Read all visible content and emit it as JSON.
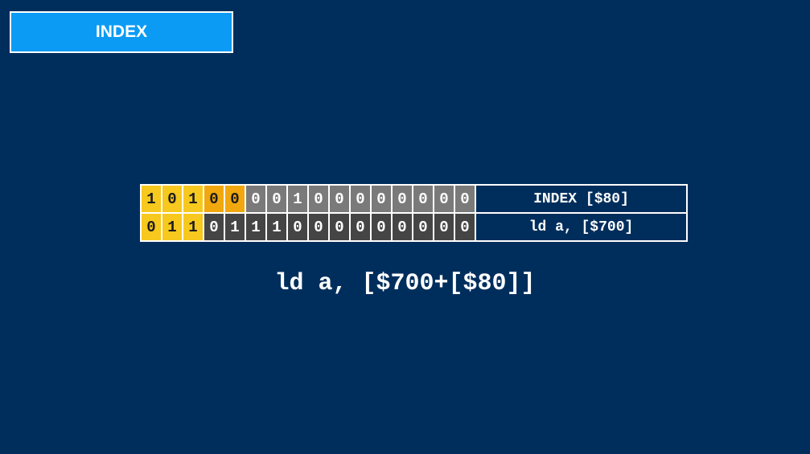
{
  "title": "INDEX",
  "rows": [
    {
      "bits": [
        "1",
        "0",
        "1",
        "0",
        "0",
        "0",
        "0",
        "1",
        "0",
        "0",
        "0",
        "0",
        "0",
        "0",
        "0",
        "0"
      ],
      "colors": [
        "yellow",
        "yellow",
        "yellow",
        "orange",
        "orange",
        "lightgray",
        "lightgray",
        "lightgray",
        "lightgray",
        "lightgray",
        "lightgray",
        "lightgray",
        "lightgray",
        "lightgray",
        "lightgray",
        "lightgray"
      ],
      "label": "INDEX [$80]"
    },
    {
      "bits": [
        "0",
        "1",
        "1",
        "0",
        "1",
        "1",
        "1",
        "0",
        "0",
        "0",
        "0",
        "0",
        "0",
        "0",
        "0",
        "0"
      ],
      "colors": [
        "yellow",
        "yellow",
        "yellow",
        "darkgray",
        "darkgray",
        "darkgray",
        "darkgray",
        "darkgray",
        "darkgray",
        "darkgray",
        "darkgray",
        "darkgray",
        "darkgray",
        "darkgray",
        "darkgray",
        "darkgray"
      ],
      "label": "ld a, [$700]"
    }
  ],
  "expression": "ld a, [$700+[$80]]",
  "colors": {
    "background": "#002e5c",
    "title_box": "#0b9bf5",
    "yellow": "#f7c81e",
    "orange": "#f0a80e",
    "lightgray": "#7a7a7a",
    "darkgray": "#454545"
  }
}
